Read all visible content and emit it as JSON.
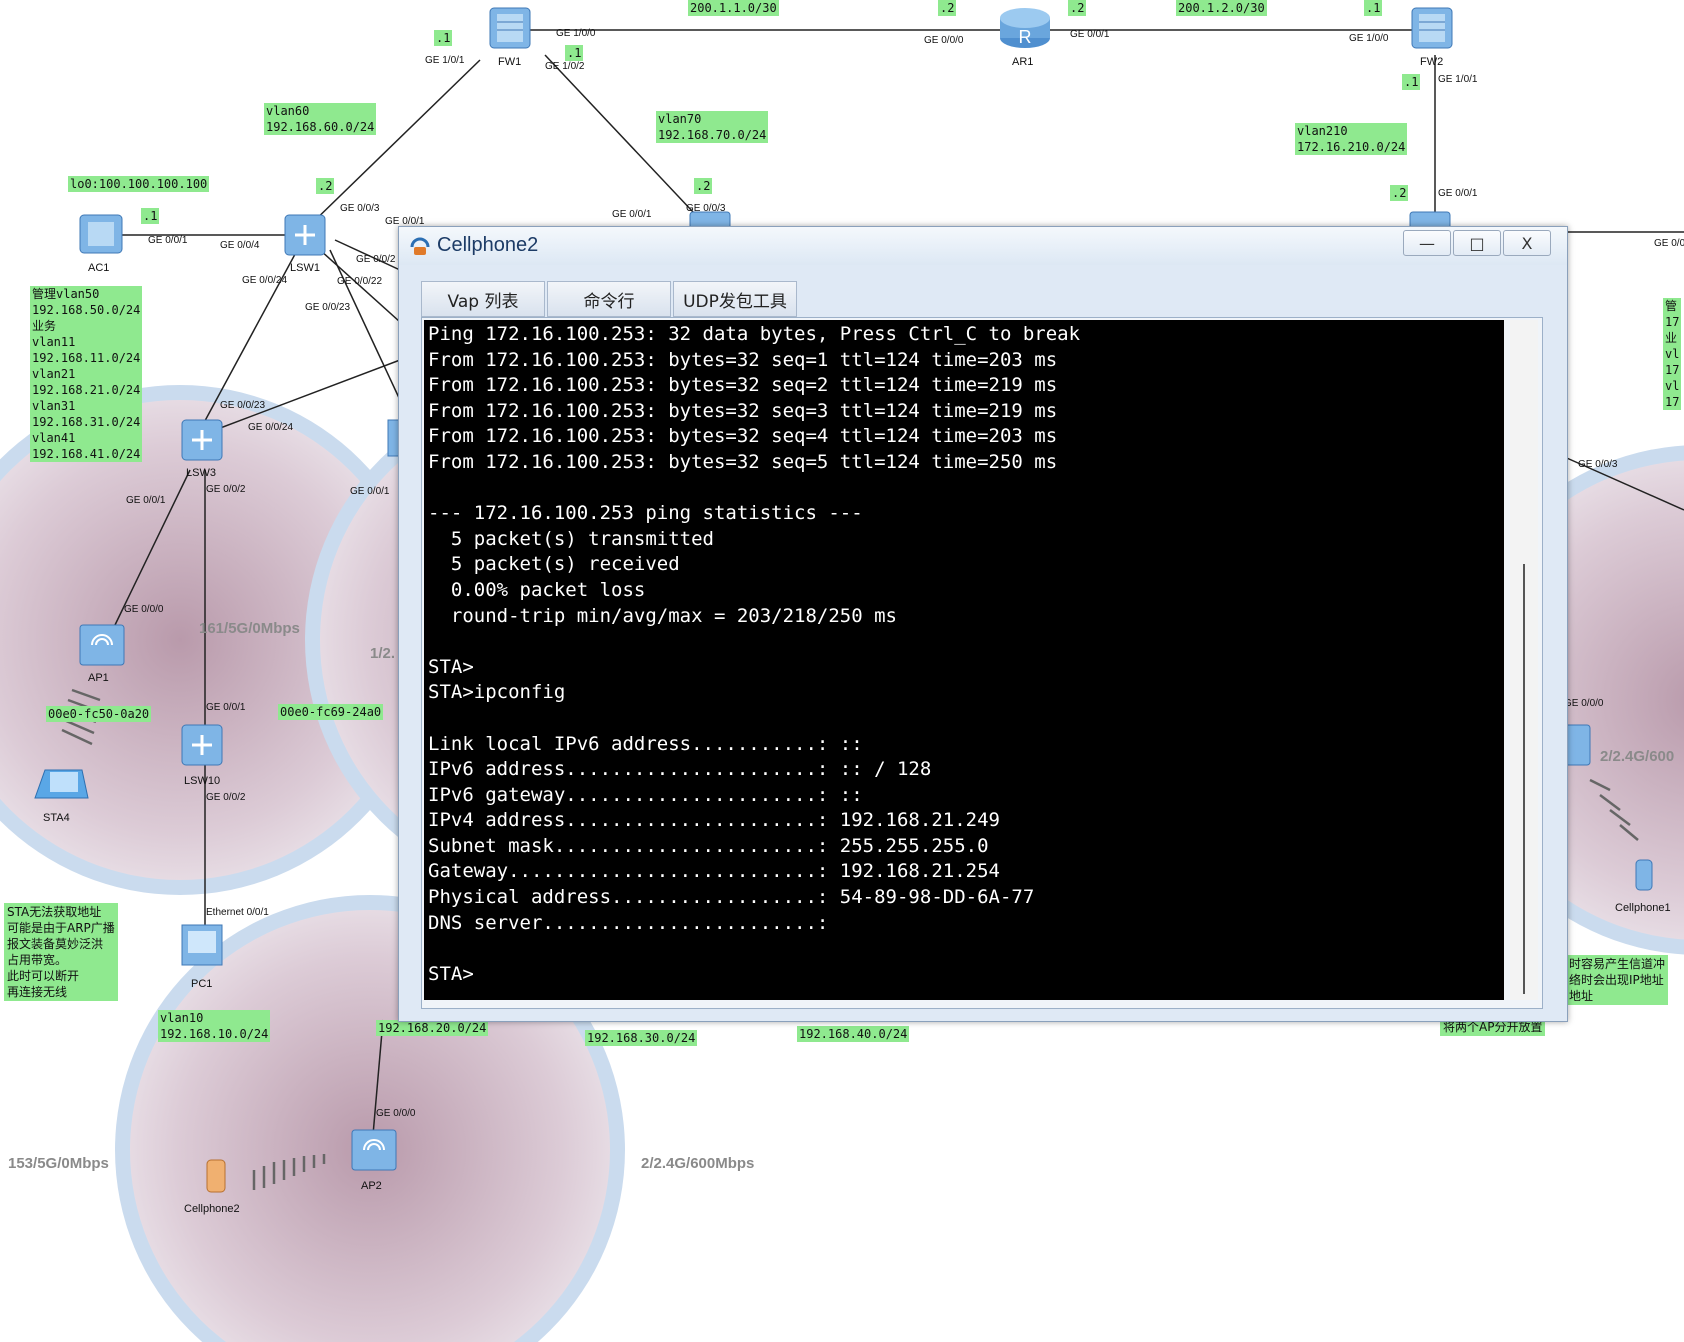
{
  "topology": {
    "devices": {
      "fw1": "FW1",
      "ar1": "AR1",
      "fw2": "FW2",
      "ac1": "AC1",
      "lsw1": "LSW1",
      "lsw3": "LSW3",
      "lsw10": "LSW10",
      "ap1": "AP1",
      "ap2": "AP2",
      "sta4": "STA4",
      "pc1": "PC1",
      "cellphone2": "Cellphone2",
      "cellphone1": "Cellphone1"
    },
    "labels": {
      "net_200_1_1": "200.1.1.0/30",
      "net_200_1_2": "200.1.2.0/30",
      "vlan60": "vlan60\n192.168.60.0/24",
      "vlan70": "vlan70\n192.168.70.0/24",
      "vlan210": "vlan210\n172.16.210.0/24",
      "lo0": "lo0:100.100.100.100",
      "mgmt_block": "管理vlan50\n192.168.50.0/24\n业务\nvlan11\n192.168.11.0/24\nvlan21\n192.168.21.0/24\nvlan31\n192.168.31.0/24\nvlan41\n192.168.41.0/24",
      "mac_ap1": "00e0-fc50-0a20",
      "mac_ap2": "00e0-fc69-24a0",
      "vlan10": "vlan10\n192.168.10.0/24",
      "vlan20": "192.168.20.0/24",
      "vlan30": "192.168.30.0/24",
      "vlan40": "192.168.40.0/24",
      "right_partial": "管\n17\n业\nvl\n17\nvl\n17",
      "sta_note": "STA无法获取地址\n可能是由于ARP广播\n报文装备莫妙泛洪\n占用带宽。\n此时可以断开\n再连接无线",
      "right_note": "时容易产生信道冲\n络时会出现IP地址\n地址",
      "right_note2": "将两个AP分开放置"
    },
    "ips": {
      "fw1_left": ".1",
      "fw1_right": ".1",
      "fw1_top": ".1",
      "ar1_left": ".2",
      "ar1_right": ".2",
      "fw2_left": ".1",
      "fw2_down": ".1",
      "lsw1_up": ".2",
      "ac1": ".1",
      "lsw_right": ".2",
      "sw_fw2": ".2"
    },
    "ports": {
      "fw1_g100": "GE 1/0/0",
      "fw1_g101": "GE 1/0/1",
      "fw1_g102": "GE 1/0/2",
      "ar1_g000": "GE 0/0/0",
      "ar1_g001": "GE 0/0/1",
      "fw2_g100": "GE 1/0/0",
      "fw2_g101": "GE 1/0/1",
      "sw2_g001": "GE 0/0/1",
      "lsw1_g003": "GE 0/0/3",
      "lsw1_g004": "GE 0/0/4",
      "lsw1_g001b": "GE 0/0/1",
      "ac1_g001": "GE 0/0/1",
      "lsw1_g0024": "GE 0/0/24",
      "lsw1_g0022": "GE 0/0/22",
      "lsw1_g0023": "GE 0/0/23",
      "lsw1_g002": "GE 0/0/2",
      "sw_g001": "GE 0/0/1",
      "sw_g003": "GE 0/0/3",
      "lsw3_g0023": "GE 0/0/23",
      "lsw3_g0024": "GE 0/0/24",
      "lsw3_g001": "GE 0/0/1",
      "lsw3_g002": "GE 0/0/2",
      "ap1_g000": "GE 0/0/0",
      "lsw10_g001": "GE 0/0/1",
      "lsw10_g002": "GE 0/0/2",
      "pc1_eth": "Ethernet 0/0/1",
      "ap2_g000": "GE 0/0/0",
      "mid_g001": "GE 0/0/1",
      "right_g003": "GE 0/0/3",
      "right_g000": "GE 0/0/0",
      "right_top": "GE 0/0"
    },
    "rates": {
      "r1": "161/5G/0Mbps",
      "r2": "1/2.",
      "r3": "153/5G/0Mbps",
      "r4": "2/2.4G/600Mbps",
      "r5": "2/2.4G/600"
    }
  },
  "window": {
    "title": "Cellphone2",
    "buttons": {
      "minimize": "—",
      "maximize": "□",
      "close": "X"
    },
    "tabs": [
      "Vap 列表",
      "命令行",
      "UDP发包工具"
    ],
    "console_lines": [
      "Ping 172.16.100.253: 32 data bytes, Press Ctrl_C to break",
      "From 172.16.100.253: bytes=32 seq=1 ttl=124 time=203 ms",
      "From 172.16.100.253: bytes=32 seq=2 ttl=124 time=219 ms",
      "From 172.16.100.253: bytes=32 seq=3 ttl=124 time=219 ms",
      "From 172.16.100.253: bytes=32 seq=4 ttl=124 time=203 ms",
      "From 172.16.100.253: bytes=32 seq=5 ttl=124 time=250 ms",
      "",
      "--- 172.16.100.253 ping statistics ---",
      "  5 packet(s) transmitted",
      "  5 packet(s) received",
      "  0.00% packet loss",
      "  round-trip min/avg/max = 203/218/250 ms",
      "",
      "STA>",
      "STA>ipconfig",
      "",
      "Link local IPv6 address...........: ::",
      "IPv6 address......................: :: / 128",
      "IPv6 gateway......................: ::",
      "IPv4 address......................: 192.168.21.249",
      "Subnet mask.......................: 255.255.255.0",
      "Gateway...........................: 192.168.21.254",
      "Physical address..................: 54-89-98-DD-6A-77",
      "DNS server........................:",
      "",
      "STA>"
    ]
  },
  "colors": {
    "label_bg": "#8fe98f",
    "console_bg": "#000000",
    "console_fg": "#ffffff",
    "coverage": "#d3c3cf",
    "coverage_ring": "#c6d9ec"
  }
}
